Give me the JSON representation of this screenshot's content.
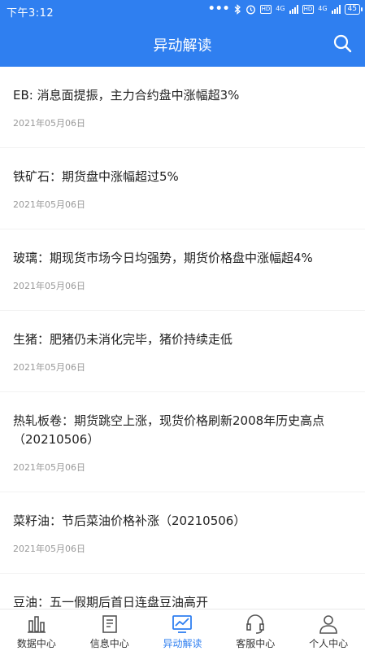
{
  "status_bar": {
    "time": "下午3:12",
    "network1": "4G",
    "network2": "4G",
    "hd1": "HD",
    "hd2": "HD",
    "battery": "45"
  },
  "nav": {
    "title": "异动解读"
  },
  "articles": [
    {
      "headline": "EB: 消息面提振，主力合约盘中涨幅超3%",
      "date": "2021年05月06日"
    },
    {
      "headline": "铁矿石：期货盘中涨幅超过5%",
      "date": "2021年05月06日"
    },
    {
      "headline": "玻璃：期现货市场今日均强势，期货价格盘中涨幅超4%",
      "date": "2021年05月06日"
    },
    {
      "headline": "生猪：肥猪仍未消化完毕，猪价持续走低",
      "date": "2021年05月06日"
    },
    {
      "headline": "热轧板卷：期货跳空上涨，现货价格刷新2008年历史高点（20210506）",
      "date": "2021年05月06日"
    },
    {
      "headline": "菜籽油：节后菜油价格补涨（20210506）",
      "date": "2021年05月06日"
    },
    {
      "headline": "豆油：五一假期后首日连盘豆油高开",
      "date": ""
    }
  ],
  "tabs": [
    {
      "label": "数据中心",
      "icon": "bar-chart-icon"
    },
    {
      "label": "信息中心",
      "icon": "document-icon"
    },
    {
      "label": "异动解读",
      "icon": "monitor-chart-icon"
    },
    {
      "label": "客服中心",
      "icon": "headset-icon"
    },
    {
      "label": "个人中心",
      "icon": "person-icon"
    }
  ],
  "colors": {
    "primary": "#2f7ff0",
    "text": "#222222",
    "date": "#999999"
  }
}
